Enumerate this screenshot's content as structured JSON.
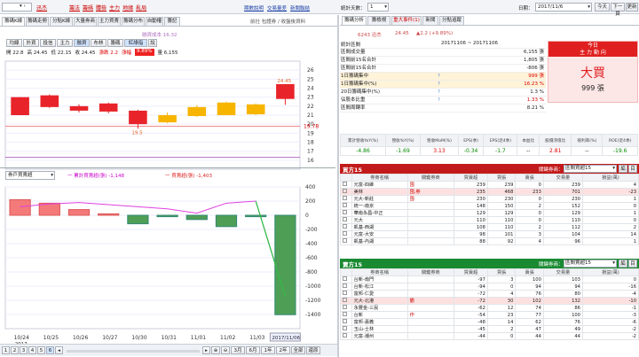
{
  "topbar": {
    "stock_code_placeholder": "",
    "stock_name": "迅杰",
    "links": [
      "籌法",
      "籌碼",
      "體檢",
      "主力",
      "地緣",
      "亂局"
    ],
    "right_links": [
      "期數說明",
      "交易量差",
      "新聞聯結"
    ],
    "days_label": "統計天數：",
    "days_value": "1",
    "date_label": "日期：",
    "date_value": "2017/11/6",
    "today_btn": "今天",
    "next_btn": "下一頁",
    "update_btn": "更新"
  },
  "left": {
    "tabs": [
      "籌碼K線",
      "籌碼走勢",
      "分點K線",
      "大量券商",
      "主力買賣",
      "籌碼分布",
      "自動權",
      "籌記"
    ],
    "info": "前社 包證券 / 收盤後資料",
    "subtabs": [
      "均線",
      "外資",
      "投信",
      "主力",
      "融資",
      "布林",
      "籌碼",
      "紅綠指",
      "說"
    ],
    "cost_label": "融資成本 16.32",
    "ohlc": {
      "open": "開 22.8",
      "high": "高 24.45",
      "low": "低 22.15",
      "close": "收 24.45",
      "change": "漲跌 2.2",
      "pct_label": "漲幅",
      "pct": "9.89%",
      "vol": "量 6,155"
    },
    "price_hi_label": "24.45",
    "price_lo_label": "19.5",
    "price_mark": "19.78",
    "lower": {
      "dropdown": "券戶買賣超",
      "legend1": "一 累計買賣超(張) -1,148",
      "legend2": "一 買賣超(張) -1,403"
    },
    "date_tag": "2017/11/06",
    "bottom": {
      "pages": [
        "1",
        "2",
        "3",
        "4",
        "5",
        "6"
      ],
      "ranges": [
        "3月",
        "6月",
        "1年",
        "2年",
        "全部",
        "還原"
      ]
    }
  },
  "chart_data": [
    {
      "type": "candlestick",
      "categories": [
        "10/24",
        "10/25",
        "10/26",
        "10/27",
        "10/30",
        "10/31",
        "11/01",
        "11/02",
        "11/03",
        "11/06"
      ],
      "x_year": "2017",
      "ylim": [
        15,
        27
      ],
      "yticks": [
        16,
        17,
        18,
        19,
        20,
        21,
        22,
        23,
        24,
        25,
        26
      ],
      "candles": [
        {
          "o": 23.0,
          "c": 21.0,
          "h": 23.0,
          "l": 21.0,
          "color": "red"
        },
        {
          "o": 23.2,
          "c": 21.9,
          "h": 23.3,
          "l": 21.8,
          "color": "red"
        },
        {
          "o": 22.0,
          "c": 21.5,
          "h": 22.2,
          "l": 21.3,
          "color": "red"
        },
        {
          "o": 22.3,
          "c": 21.4,
          "h": 22.4,
          "l": 21.2,
          "color": "red"
        },
        {
          "o": 21.5,
          "c": 20.0,
          "h": 21.6,
          "l": 19.5,
          "color": "red"
        },
        {
          "o": 20.2,
          "c": 21.0,
          "h": 21.3,
          "l": 20.1,
          "color": "yellow"
        },
        {
          "o": 20.9,
          "c": 21.9,
          "h": 22.1,
          "l": 20.8,
          "color": "yellow"
        },
        {
          "o": 21.0,
          "c": 22.4,
          "h": 22.5,
          "l": 21.0,
          "color": "yellow"
        },
        {
          "o": 21.1,
          "c": 22.2,
          "h": 22.3,
          "l": 21.0,
          "color": "yellow"
        },
        {
          "o": 22.8,
          "c": 24.45,
          "h": 24.45,
          "l": 22.15,
          "color": "red"
        }
      ],
      "cost_line": 16.32,
      "ref_line": 19.78
    },
    {
      "type": "bar",
      "ylim": [
        -1600,
        400
      ],
      "yticks": [
        400,
        200,
        0,
        -200,
        -400,
        -600,
        -800,
        -1000,
        -1200,
        -1400
      ],
      "values": [
        220,
        170,
        80,
        20,
        -120,
        -20,
        -60,
        -160,
        -20,
        -1403
      ],
      "cumulative": [
        120,
        160,
        180,
        150,
        120,
        90,
        30,
        170,
        200,
        -1148
      ]
    }
  ],
  "right": {
    "tabs": [
      "籌碼分析",
      "籌檢視",
      "重大事件(1)",
      "新聞",
      "分點追蹤"
    ],
    "stock": "6243 迅杰",
    "price": "24.45",
    "chg": "▲2.2 (+9.89%)",
    "range_label": "統計區間",
    "range": "20171106 ~ 20171106",
    "rows": [
      {
        "k": "區間成交量",
        "v": "6,155 張",
        "c": ""
      },
      {
        "k": "區間前15名合計",
        "v": "1,805 張",
        "c": ""
      },
      {
        "k": "區間前15名合計",
        "v": "-806 張",
        "c": ""
      },
      {
        "k": "1日籌碼集中",
        "v": "999 張",
        "c": "red"
      },
      {
        "k": "1日籌碼集中(%)",
        "v": "16.23 %",
        "c": "red"
      },
      {
        "k": "20日籌碼集中(%)",
        "v": "1.3 %",
        "c": ""
      },
      {
        "k": "佔股本比重",
        "v": "1.33 %",
        "c": "red"
      },
      {
        "k": "區間周轉率",
        "v": "8.21 %",
        "c": ""
      }
    ],
    "today_label": "今日",
    "today_sub": "主 力 動 向",
    "big_label": "大買",
    "big_value": "999 張",
    "metrics_h": [
      "累計營收YoY(%)",
      "營收YoY(%)",
      "營收MoM(%)",
      "EPS(季)",
      "EPS(近4季)",
      "本益比",
      "股價淨值比",
      "殖利率(%)",
      "ROE(近4季)"
    ],
    "metrics_v": [
      "-4.86",
      "-1.69",
      "3.13",
      "-0.34",
      "-1.7",
      "--",
      "2.81",
      "--",
      "-19.6"
    ],
    "buy_title": "買方15",
    "buy_sort_label": "關鍵券商：",
    "buy_sort": "區間買超15",
    "sell_title": "賣方15",
    "sell_sort_label": "關鍵券商：",
    "sell_sort": "區間賣超15",
    "cols": [
      "券商名稱",
      "關鍵券商",
      "買賣超",
      "買張",
      "賣張",
      "交易量",
      "損益(萬)"
    ],
    "buy_rows": [
      [
        "元富-四維",
        "囤",
        "239",
        "239",
        "0",
        "239",
        "4"
      ],
      [
        "美林",
        "囤,券",
        "235",
        "468",
        "233",
        "701",
        "-23"
      ],
      [
        "元大-新莊",
        "囤",
        "230",
        "230",
        "0",
        "230",
        "1"
      ],
      [
        "統一-南京",
        "",
        "148",
        "150",
        "2",
        "152",
        "0"
      ],
      [
        "華南永昌-中正",
        "",
        "129",
        "129",
        "0",
        "129",
        "1"
      ],
      [
        "元大",
        "",
        "110",
        "110",
        "0",
        "110",
        "0"
      ],
      [
        "凱基-西湖",
        "",
        "108",
        "110",
        "2",
        "112",
        "2"
      ],
      [
        "元富-大安",
        "",
        "98",
        "101",
        "3",
        "104",
        "14"
      ],
      [
        "凱基-內湖",
        "",
        "88",
        "92",
        "4",
        "96",
        "1"
      ]
    ],
    "sell_rows": [
      [
        "台新-南門",
        "",
        "-97",
        "3",
        "100",
        "103",
        "0"
      ],
      [
        "台新-松江",
        "",
        "-94",
        "0",
        "94",
        "94",
        "-16"
      ],
      [
        "富邦-仁愛",
        "",
        "-72",
        "4",
        "76",
        "80",
        "-4"
      ],
      [
        "元大-北港",
        "霸",
        "-72",
        "30",
        "102",
        "132",
        "-10"
      ],
      [
        "永豐金-三民",
        "",
        "-62",
        "12",
        "74",
        "86",
        "-1"
      ],
      [
        "台新",
        "作",
        "-54",
        "23",
        "77",
        "100",
        "-3"
      ],
      [
        "富邦-嘉義",
        "",
        "-48",
        "14",
        "62",
        "76",
        "-6"
      ],
      [
        "玉山-士林",
        "",
        "-45",
        "2",
        "47",
        "49",
        "-2"
      ],
      [
        "元富-潮州",
        "",
        "-44",
        "0",
        "44",
        "44",
        "-2"
      ]
    ]
  }
}
